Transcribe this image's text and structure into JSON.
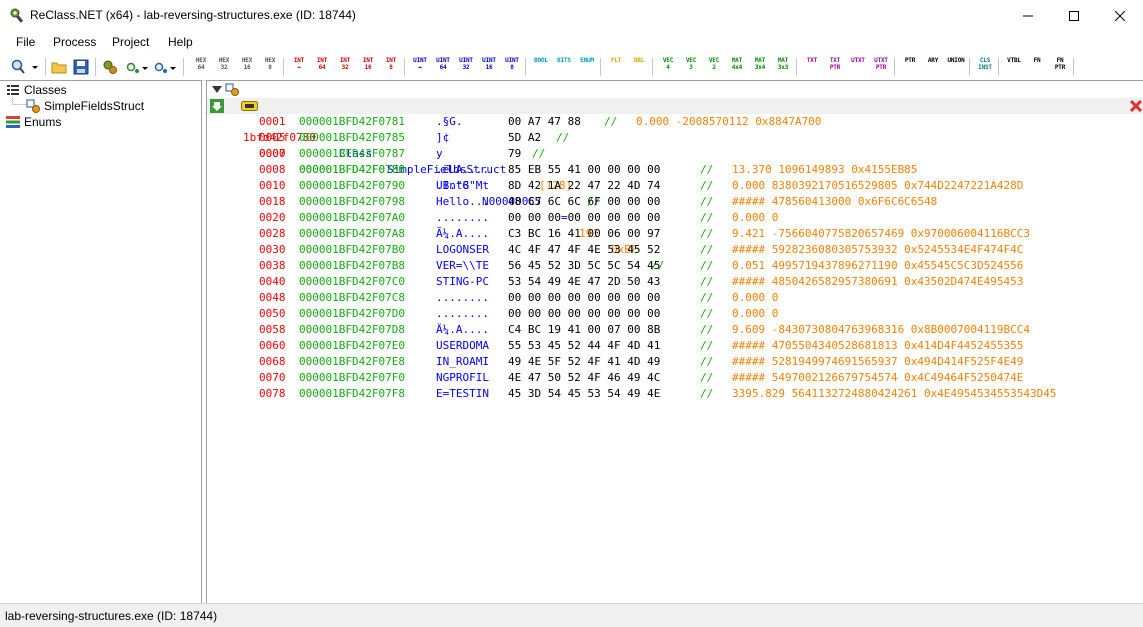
{
  "window": {
    "title": "ReClass.NET (x64) - lab-reversing-structures.exe (ID: 18744)"
  },
  "menu": [
    "File",
    "Process",
    "Project",
    "Help"
  ],
  "toolbar": {
    "groups": [
      [
        [
          "HEX",
          "64"
        ],
        [
          "HEX",
          "32"
        ],
        [
          "HEX",
          "16"
        ],
        [
          "HEX",
          "8"
        ]
      ],
      [
        [
          "INT",
          "↔"
        ],
        [
          "INT",
          "64"
        ],
        [
          "INT",
          "32"
        ],
        [
          "INT",
          "16"
        ],
        [
          "INT",
          "8"
        ]
      ],
      [
        [
          "UINT",
          "↔"
        ],
        [
          "UINT",
          "64"
        ],
        [
          "UINT",
          "32"
        ],
        [
          "UINT",
          "16"
        ],
        [
          "UINT",
          "8"
        ]
      ],
      [
        [
          "BOOL",
          ""
        ],
        [
          "BITS",
          ""
        ],
        [
          "ENUM",
          ""
        ]
      ],
      [
        [
          "FLT",
          ""
        ],
        [
          "DBL",
          ""
        ]
      ],
      [
        [
          "VEC",
          "4"
        ],
        [
          "VEC",
          "3"
        ],
        [
          "VEC",
          "2"
        ],
        [
          "MAT",
          "4x4"
        ],
        [
          "MAT",
          "3x4"
        ],
        [
          "MAT",
          "3x3"
        ]
      ],
      [
        [
          "TXT",
          ""
        ],
        [
          "TXT",
          "PTR"
        ],
        [
          "UTXT",
          ""
        ],
        [
          "UTXT",
          "PTR"
        ]
      ],
      [
        [
          "PTR",
          ""
        ],
        [
          "ARY",
          ""
        ],
        [
          "UNION",
          ""
        ]
      ],
      [
        [
          "CLS",
          "INST"
        ]
      ],
      [
        [
          "VTBL",
          ""
        ],
        [
          "FN",
          ""
        ],
        [
          "FN",
          "PTR"
        ]
      ]
    ],
    "group_colors": [
      "#555555",
      "#d00000",
      "#0000cc",
      "#00a0c0",
      "#e0a000",
      "#009000",
      "#a000a0",
      "#000000",
      "#008080",
      "#000000"
    ]
  },
  "tree": {
    "classes_label": "Classes",
    "class_item": "SimpleFieldsStruct",
    "enums_label": "Enums"
  },
  "editor": {
    "header": {
      "address": "1bfd42f0780",
      "keyword": "Class",
      "name": "SimpleFieldsStruct",
      "size": "[128]",
      "comment": "//"
    },
    "selected_row": {
      "offset": "0000",
      "address": "000001BFD42F0780",
      "type": "UInt8",
      "name": "N000000C7",
      "eq": "=",
      "value": "191",
      "hex": "0xBF",
      "comment": "//"
    },
    "rows": [
      {
        "offset": "0001",
        "address": "000001BFD42F0781",
        "text": ".§G.",
        "hex": "00 A7 47 88",
        "comment": "//",
        "value": "0.000 -2008570112 0x8847A700",
        "short": true
      },
      {
        "offset": "0005",
        "address": "000001BFD42F0785",
        "text": "]¢",
        "hex": "5D A2",
        "comment": "//",
        "value": "",
        "short": true
      },
      {
        "offset": "0007",
        "address": "000001BFD42F0787",
        "text": "y",
        "hex": "79",
        "comment": "//",
        "value": "",
        "short": true
      },
      {
        "offset": "0008",
        "address": "000001BFD42F0788",
        "text": ".ëUA....",
        "hex": "85 EB 55 41 00 00 00 00",
        "comment": "//",
        "value": "13.370 1096149893 0x4155EB85"
      },
      {
        "offset": "0010",
        "address": "000001BFD42F0790",
        "text": ".B.\"G\"Mt",
        "hex": "8D 42 1A 22 47 22 4D 74",
        "comment": "//",
        "value": "0.000 8380392170516529805 0x744D2247221A428D"
      },
      {
        "offset": "0018",
        "address": "000001BFD42F0798",
        "text": "Hello...",
        "hex": "48 65 6C 6C 6F 00 00 00",
        "comment": "//",
        "value": "##### 478560413000 0x6F6C6C6548"
      },
      {
        "offset": "0020",
        "address": "000001BFD42F07A0",
        "text": "........",
        "hex": "00 00 00 00 00 00 00 00",
        "comment": "//",
        "value": "0.000 0"
      },
      {
        "offset": "0028",
        "address": "000001BFD42F07A8",
        "text": "Ã¼.A....",
        "hex": "C3 BC 16 41 00 06 00 97",
        "comment": "//",
        "value": "9.421 -7566040775820657469 0x970006004116BCC3"
      },
      {
        "offset": "0030",
        "address": "000001BFD42F07B0",
        "text": "LOGONSER",
        "hex": "4C 4F 47 4F 4E 53 45 52",
        "comment": "//",
        "value": "##### 5928236080305753932 0x5245534E4F474F4C"
      },
      {
        "offset": "0038",
        "address": "000001BFD42F07B8",
        "text": "VER=\\\\TE",
        "hex": "56 45 52 3D 5C 5C 54 45",
        "comment": "//",
        "value": "0.051 4995719437896271190 0x45545C5C3D524556"
      },
      {
        "offset": "0040",
        "address": "000001BFD42F07C0",
        "text": "STING-PC",
        "hex": "53 54 49 4E 47 2D 50 43",
        "comment": "//",
        "value": "##### 4850426582957380691 0x43502D474E495453"
      },
      {
        "offset": "0048",
        "address": "000001BFD42F07C8",
        "text": "........",
        "hex": "00 00 00 00 00 00 00 00",
        "comment": "//",
        "value": "0.000 0"
      },
      {
        "offset": "0050",
        "address": "000001BFD42F07D0",
        "text": "........",
        "hex": "00 00 00 00 00 00 00 00",
        "comment": "//",
        "value": "0.000 0"
      },
      {
        "offset": "0058",
        "address": "000001BFD42F07D8",
        "text": "Ä¼.A....",
        "hex": "C4 BC 19 41 00 07 00 8B",
        "comment": "//",
        "value": "9.609 -8430730804763968316 0x8B0007004119BCC4"
      },
      {
        "offset": "0060",
        "address": "000001BFD42F07E0",
        "text": "USERDOMA",
        "hex": "55 53 45 52 44 4F 4D 41",
        "comment": "//",
        "value": "##### 4705504340528681813 0x414D4F4452455355"
      },
      {
        "offset": "0068",
        "address": "000001BFD42F07E8",
        "text": "IN_ROAMI",
        "hex": "49 4E 5F 52 4F 41 4D 49",
        "comment": "//",
        "value": "##### 5281949974691565937 0x494D414F525F4E49"
      },
      {
        "offset": "0070",
        "address": "000001BFD42F07F0",
        "text": "NGPROFIL",
        "hex": "4E 47 50 52 4F 46 49 4C",
        "comment": "//",
        "value": "##### 5497002126679754574 0x4C49464F5250474E"
      },
      {
        "offset": "0078",
        "address": "000001BFD42F07F8",
        "text": "E=TESTIN",
        "hex": "45 3D 54 45 53 54 49 4E",
        "comment": "//",
        "value": "3395.829 5641132724880424261 0x4E4954534553543D45"
      }
    ]
  },
  "status": {
    "text": "lab-reversing-structures.exe (ID: 18744)"
  }
}
